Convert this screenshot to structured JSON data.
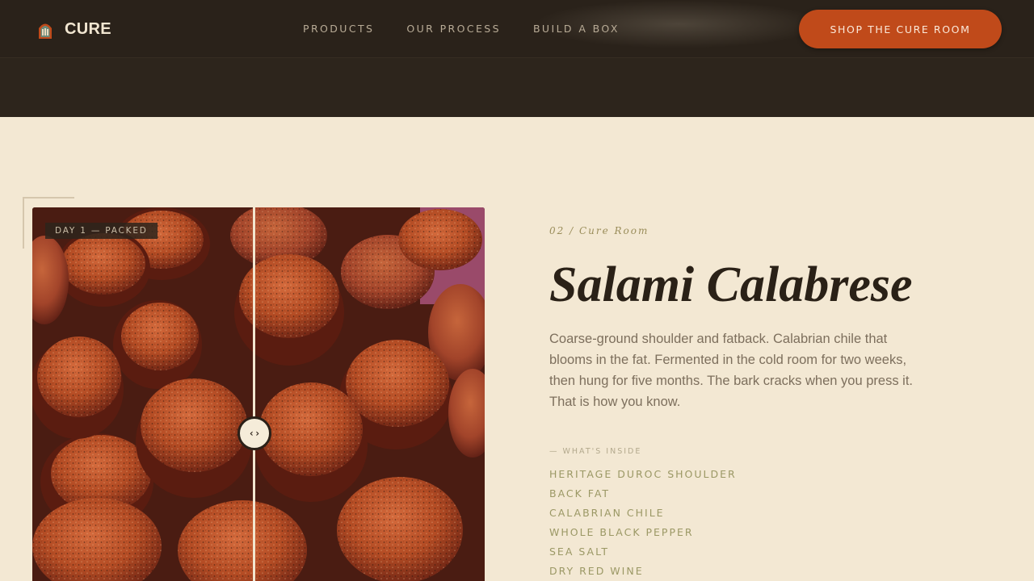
{
  "nav": {
    "logo_text": "CURE",
    "menu": [
      "PRODUCTS",
      "OUR PROCESS",
      "BUILD A BOX"
    ],
    "cta_label": "SHOP THE CURE ROOM"
  },
  "hero": {
    "badge": "DAY 1 — PACKED",
    "eyebrow": "02 / Cure Room",
    "title": "Salami Calabrese",
    "description": "Coarse-ground shoulder and fatback. Calabrian chile that blooms in the fat. Fermented in the cold room for two weeks, then hung for five months. The bark cracks when you press it. That is how you know.",
    "inside_label": "— WHAT'S INSIDE",
    "ingredients": [
      "HERITAGE DUROC SHOULDER",
      "BACK FAT",
      "CALABRIAN CHILE",
      "WHOLE BLACK PEPPER",
      "SEA SALT",
      "DRY RED WINE"
    ],
    "handle_glyph": "‹›"
  },
  "colors": {
    "nav_bg": "#2a221a",
    "page_bg": "#f3e8d3",
    "accent": "#c04a1a",
    "title": "#2a2117",
    "ingredient": "#9b9865"
  }
}
